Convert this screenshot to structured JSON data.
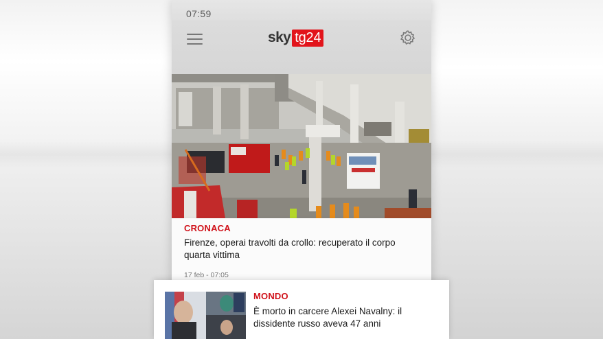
{
  "status_bar": {
    "time": "07:59"
  },
  "app_bar": {
    "logo_sky": "sky",
    "logo_tg": "tg24",
    "menu_icon": "hamburger-menu-icon",
    "settings_icon": "gear-icon"
  },
  "hero_article": {
    "image": "building-collapse-photo",
    "category": "CRONACA",
    "title": "Firenze, operai travolti da crollo: recuperato il corpo quarta vittima",
    "date": "17 feb - 07:05"
  },
  "second_article": {
    "image": "navalny-photo-thumbnail",
    "category": "MONDO",
    "title": "È morto in carcere Alexei Navalny: il dissidente russo aveva 47 anni"
  },
  "colors": {
    "brand_red": "#e2141b",
    "category_red": "#d0121a",
    "app_bar_bg": "#d8d8d8"
  }
}
